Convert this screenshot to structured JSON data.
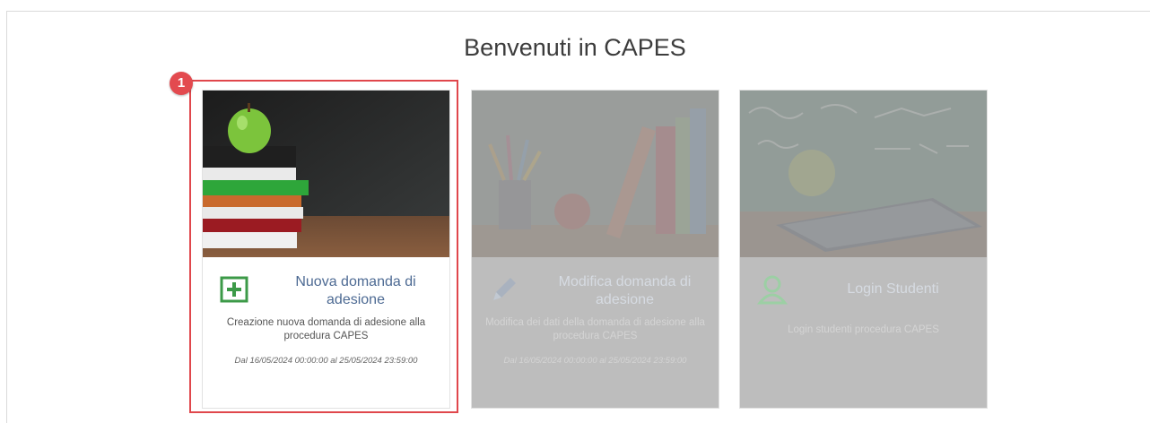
{
  "page": {
    "title": "Benvenuti in CAPES"
  },
  "annotation": {
    "step_number": "1",
    "highlight_color": "#e0474c"
  },
  "cards": [
    {
      "title": "Nuova domanda di adesione",
      "description": "Creazione nuova domanda di adesione alla procedura CAPES",
      "dates": "Dal 16/05/2024 00:00:00 al 25/05/2024 23:59:00",
      "icon": "plus-square-icon",
      "state": "enabled",
      "image": "apple-on-books-image"
    },
    {
      "title": "Modifica domanda di adesione",
      "description": "Modifica dei dati della domanda di adesione alla procedura CAPES",
      "dates": "Dal 16/05/2024 00:00:00 al 25/05/2024 23:59:00",
      "icon": "pencil-icon",
      "state": "disabled",
      "image": "books-and-pencils-image"
    },
    {
      "title": "Login Studenti",
      "description": "Login studenti procedura CAPES",
      "icon": "user-icon",
      "state": "disabled",
      "image": "apple-tablet-chalkboard-image"
    }
  ],
  "colors": {
    "accent_green": "#3c9a48",
    "title_blue": "#4d6a93",
    "badge_red": "#e34a4f"
  }
}
